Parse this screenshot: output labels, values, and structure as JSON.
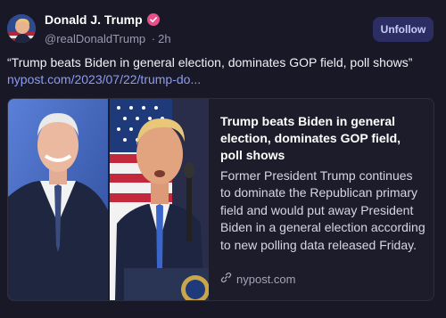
{
  "author": {
    "name": "Donald J. Trump",
    "handle": "@realDonaldTrump",
    "time": "2h",
    "separator": "·",
    "avatar_icon": "avatar-portrait",
    "verified_icon": "verified-badge-icon",
    "verified_color": "#e6508a"
  },
  "actions": {
    "follow_label": "Unfollow"
  },
  "post": {
    "text": "“Trump beats Biden in general election, dominates GOP field, poll shows”",
    "link_text": "nypost.com/2023/07/22/trump-do..."
  },
  "card": {
    "title": "Trump beats Biden in general election, dominates GOP field, poll shows",
    "description": "Former President Trump continues to dominate the Republican primary field and would put away President Biden in a general election according to new polling data released Friday.",
    "domain": "nypost.com",
    "domain_icon": "link-icon"
  },
  "colors": {
    "background": "#191826",
    "link": "#8c9bf5",
    "button_bg": "#2b2d63",
    "button_text": "#c9cdfb"
  }
}
